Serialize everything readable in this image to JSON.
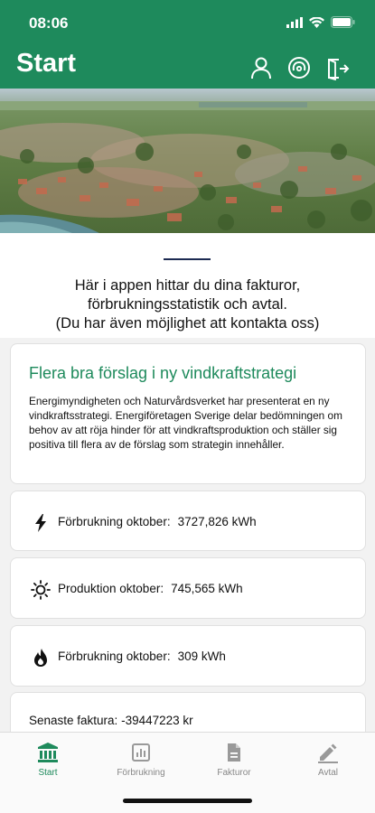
{
  "status_bar": {
    "time": "08:06"
  },
  "header": {
    "title": "Start"
  },
  "intro": {
    "lines": [
      "Här i appen hittar du dina fakturor,",
      "förbrukningsstatistik och avtal.",
      "(Du har även möjlighet att kontakta oss)"
    ]
  },
  "news": {
    "title": "Flera bra förslag i ny vindkraftstrategi",
    "body": "Energimyndigheten och Naturvårdsverket har presenterat en ny vindkraftsstrategi. Energiföretagen Sverige delar bedömningen om behov av att röja hinder för att vindkraftsproduktion och ställer sig positiva till flera av de förslag som strategin innehåller."
  },
  "stats": [
    {
      "icon": "lightning-icon",
      "label": "Förbrukning oktober:",
      "value": "3727,826 kWh"
    },
    {
      "icon": "sun-icon",
      "label": "Produktion oktober:",
      "value": "745,565 kWh"
    },
    {
      "icon": "flame-icon",
      "label": "Förbrukning oktober:",
      "value": "309 kWh"
    }
  ],
  "invoice": {
    "label": "Senaste faktura:",
    "value": "-39447223 kr"
  },
  "tabs": [
    {
      "label": "Start",
      "icon": "bank-icon",
      "active": true
    },
    {
      "label": "Förbrukning",
      "icon": "chart-icon",
      "active": false
    },
    {
      "label": "Fakturor",
      "icon": "document-icon",
      "active": false
    },
    {
      "label": "Avtal",
      "icon": "pen-icon",
      "active": false
    }
  ],
  "colors": {
    "brand_green": "#1e8a5c",
    "tab_inactive": "#888888"
  }
}
